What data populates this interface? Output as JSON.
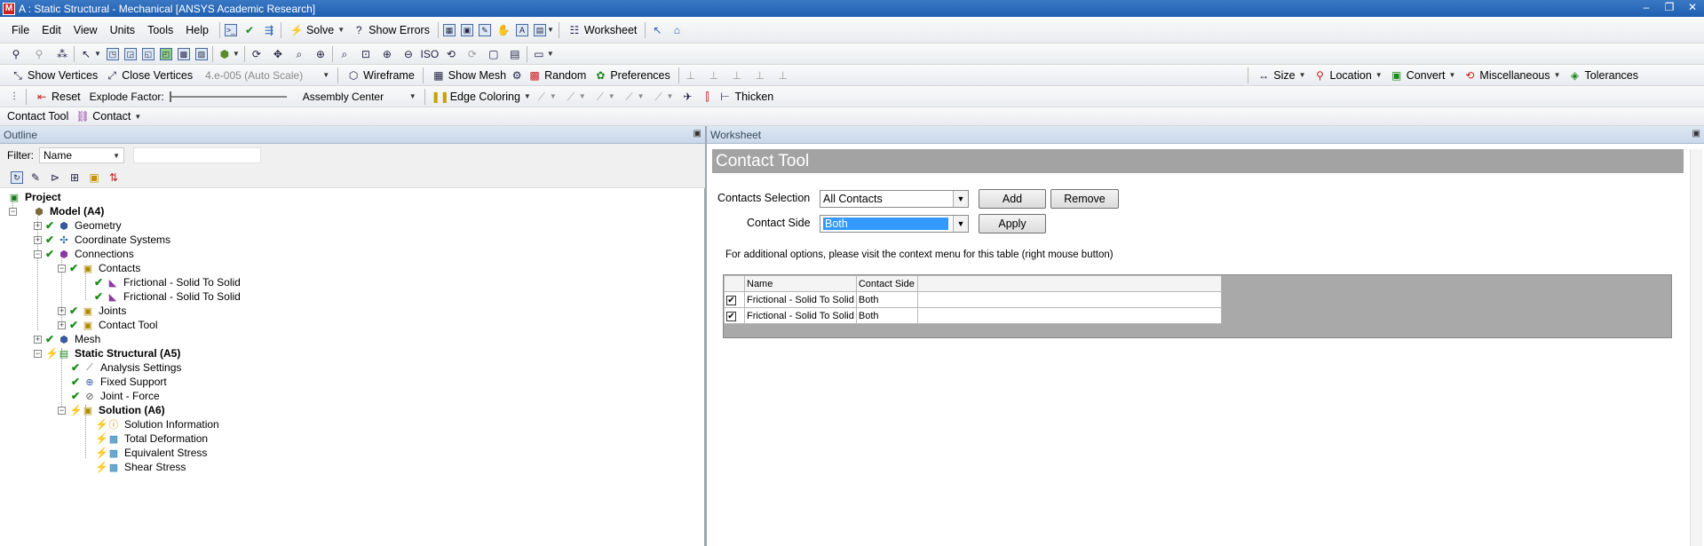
{
  "window": {
    "title": "A : Static Structural - Mechanical [ANSYS Academic Research]",
    "app_icon": "M"
  },
  "menu": {
    "items": [
      "File",
      "Edit",
      "View",
      "Units",
      "Tools",
      "Help"
    ],
    "solve": "Solve",
    "show_errors": "Show Errors",
    "worksheet": "Worksheet"
  },
  "toolbar3": {
    "show_vertices": "Show Vertices",
    "close_vertices": "Close Vertices",
    "scale": "4.e-005 (Auto Scale)",
    "wireframe": "Wireframe",
    "show_mesh": "Show Mesh",
    "random": "Random",
    "preferences": "Preferences",
    "size": "Size",
    "location": "Location",
    "convert": "Convert",
    "miscellaneous": "Miscellaneous",
    "tolerances": "Tolerances"
  },
  "toolbar4": {
    "reset": "Reset",
    "explode_factor": "Explode Factor:",
    "assembly_center": "Assembly Center",
    "edge_coloring": "Edge Coloring",
    "thicken": "Thicken"
  },
  "toolbar5": {
    "contact_tool": "Contact Tool",
    "contact": "Contact"
  },
  "outline": {
    "header": "Outline",
    "filter_label": "Filter:",
    "filter_value": "Name",
    "tree": [
      {
        "label": "Project",
        "bold": true
      },
      {
        "label": "Model (A4)",
        "bold": true
      },
      {
        "label": "Geometry"
      },
      {
        "label": "Coordinate Systems"
      },
      {
        "label": "Connections"
      },
      {
        "label": "Contacts"
      },
      {
        "label": "Frictional - Solid To Solid"
      },
      {
        "label": "Frictional - Solid To Solid"
      },
      {
        "label": "Joints"
      },
      {
        "label": "Contact Tool"
      },
      {
        "label": "Mesh"
      },
      {
        "label": "Static Structural (A5)",
        "bold": true
      },
      {
        "label": "Analysis Settings"
      },
      {
        "label": "Fixed Support"
      },
      {
        "label": "Joint - Force"
      },
      {
        "label": "Solution (A6)",
        "bold": true
      },
      {
        "label": "Solution Information"
      },
      {
        "label": "Total Deformation"
      },
      {
        "label": "Equivalent Stress"
      },
      {
        "label": "Shear Stress"
      }
    ]
  },
  "worksheet": {
    "header": "Worksheet",
    "title": "Contact Tool",
    "contacts_selection_label": "Contacts Selection",
    "contacts_selection_value": "All Contacts",
    "contact_side_label": "Contact Side",
    "contact_side_value": "Both",
    "add": "Add",
    "remove": "Remove",
    "apply": "Apply",
    "note": "For additional options, please visit the context menu for this table (right mouse button)",
    "columns": [
      "",
      "Name",
      "Contact Side"
    ],
    "rows": [
      {
        "checked": "✔",
        "name": "Frictional - Solid To Solid",
        "side": "Both"
      },
      {
        "checked": "✔",
        "name": "Frictional - Solid To Solid",
        "side": "Both"
      }
    ]
  }
}
